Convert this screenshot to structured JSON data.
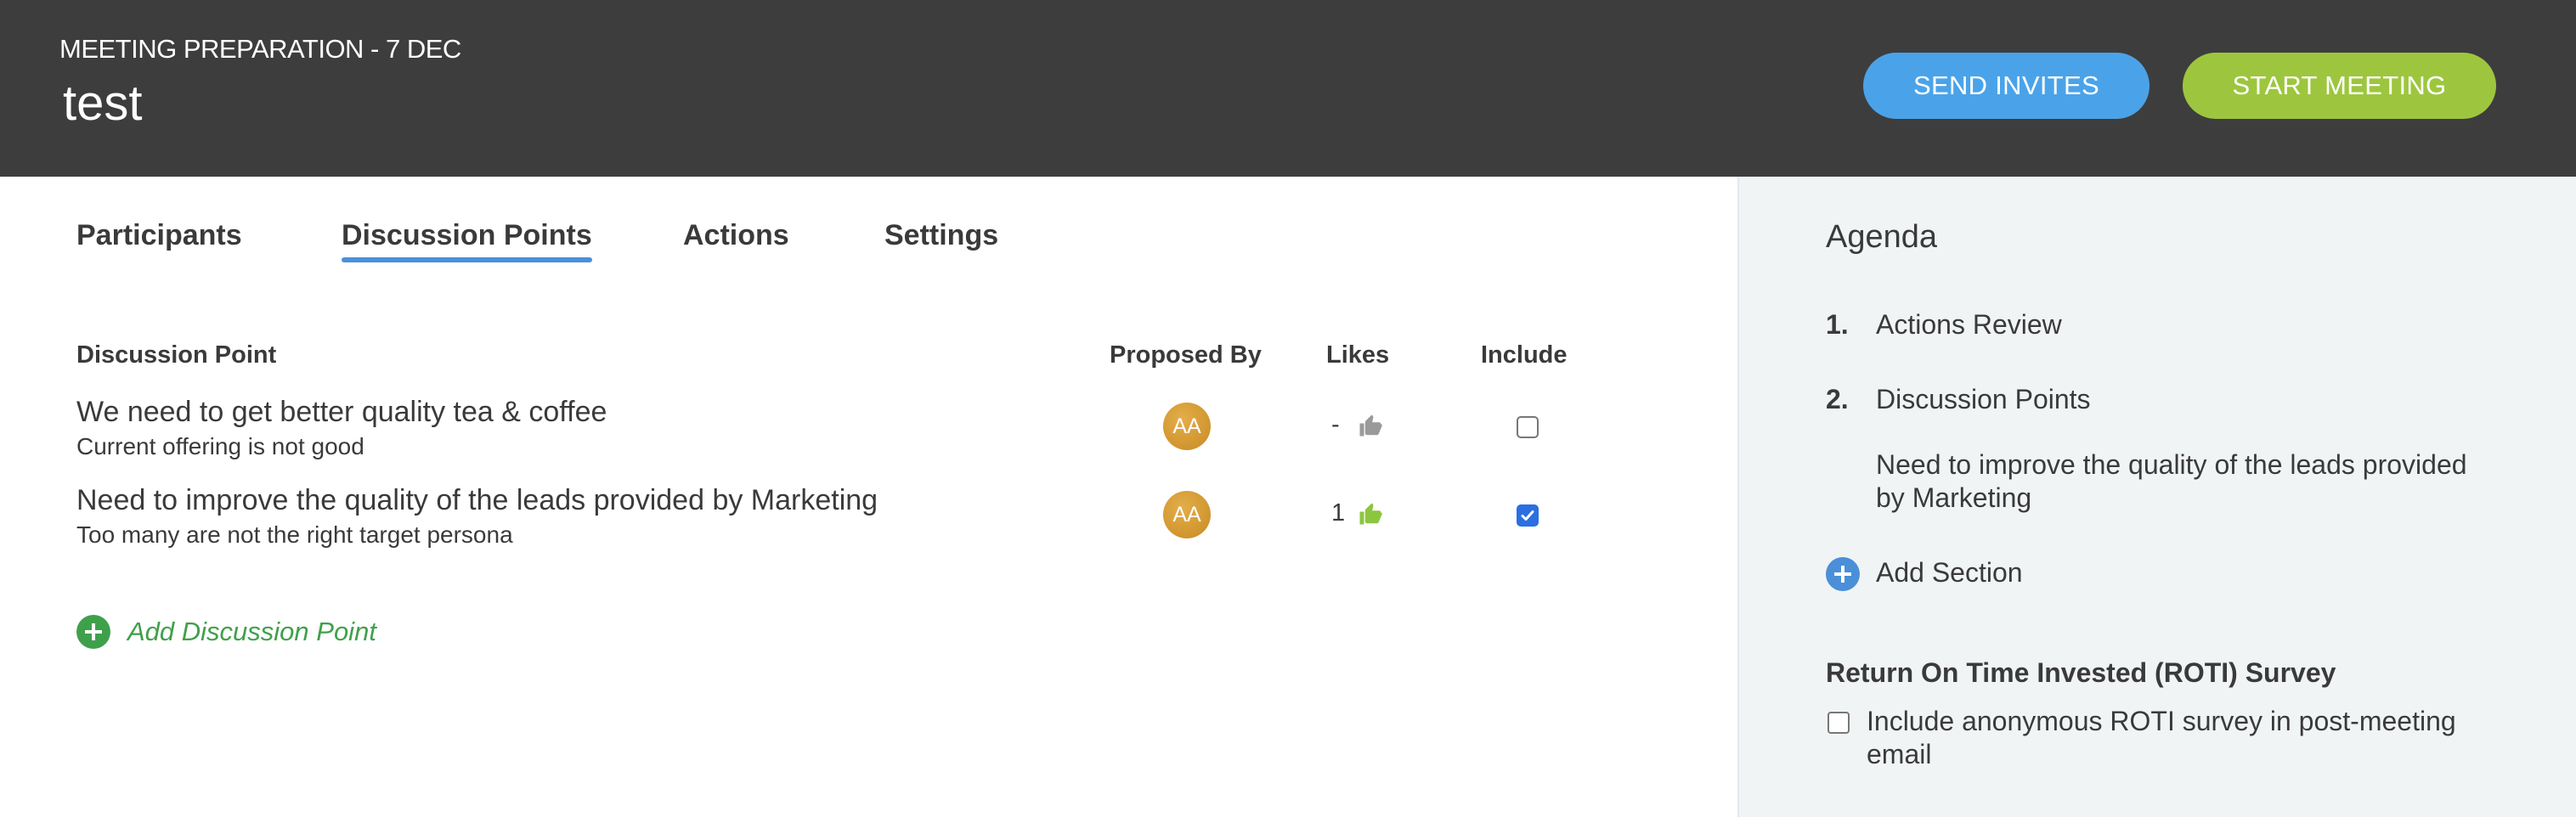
{
  "header": {
    "subtitle": "MEETING PREPARATION - 7 DEC",
    "title": "test",
    "send_invites_label": "SEND INVITES",
    "start_meeting_label": "START MEETING"
  },
  "tabs": [
    {
      "label": "Participants",
      "active": false
    },
    {
      "label": "Discussion Points",
      "active": true
    },
    {
      "label": "Actions",
      "active": false
    },
    {
      "label": "Settings",
      "active": false
    }
  ],
  "table": {
    "columns": [
      "Discussion Point",
      "Proposed By",
      "Likes",
      "Include"
    ],
    "rows": [
      {
        "title": "We need to get better quality tea & coffee",
        "description": "Current offering is not good",
        "proposed_by": "AA",
        "likes": "-",
        "liked": false,
        "include": false
      },
      {
        "title": "Need to improve the quality of the leads provided by Marketing",
        "description": "Too many are not the right target persona",
        "proposed_by": "AA",
        "likes": "1",
        "liked": true,
        "include": true
      }
    ],
    "add_label": "Add Discussion Point"
  },
  "agenda": {
    "title": "Agenda",
    "items": [
      {
        "number": "1.",
        "label": "Actions Review"
      },
      {
        "number": "2.",
        "label": "Discussion Points"
      }
    ],
    "sub_item": "Need to improve the quality of the leads provided by Marketing",
    "add_section_label": "Add Section",
    "roti_title": "Return On Time Invested (ROTI) Survey",
    "roti_checkbox_label": "Include anonymous ROTI survey in post-meeting email",
    "roti_checked": false
  },
  "colors": {
    "header_bg": "#3d3d3d",
    "send_invites": "#4aa3e9",
    "start_meeting": "#9dc63e",
    "add_green": "#3fa04b",
    "like_active": "#8cc63f",
    "like_inactive": "#9a9a9a",
    "tab_underline": "#4a90d9",
    "sidebar_bg": "#f1f4f5"
  }
}
